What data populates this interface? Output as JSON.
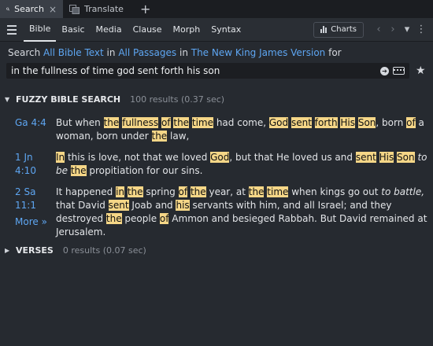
{
  "tabs": [
    {
      "label": "Search",
      "icon": "search-icon",
      "active": true,
      "close": "×"
    },
    {
      "label": "Translate",
      "icon": "translate-icon",
      "active": false
    }
  ],
  "tab_add": "+",
  "toolbar": {
    "items": [
      "Bible",
      "Basic",
      "Media",
      "Clause",
      "Morph",
      "Syntax"
    ],
    "active": "Bible",
    "charts_label": "Charts"
  },
  "scope": {
    "w1": "Search ",
    "link1": "All Bible Text",
    "w2": " in ",
    "link2": "All Passages",
    "w3": " in ",
    "link3": "The New King James Version",
    "w4": " for"
  },
  "search": {
    "value": "in the fullness of time god sent forth his son"
  },
  "fuzzy": {
    "title": "FUZZY BIBLE SEARCH",
    "count": "100 results (0.37 sec)"
  },
  "results": [
    {
      "ref": "Ga 4:4",
      "segments": [
        {
          "t": "But when "
        },
        {
          "t": "the",
          "h": true
        },
        {
          "t": " "
        },
        {
          "t": "fullness",
          "h": true
        },
        {
          "t": " "
        },
        {
          "t": "of",
          "h": true
        },
        {
          "t": " "
        },
        {
          "t": "the",
          "h": true
        },
        {
          "t": " "
        },
        {
          "t": "time",
          "h": true
        },
        {
          "t": " had come, "
        },
        {
          "t": "God",
          "h": true
        },
        {
          "t": " "
        },
        {
          "t": "sent",
          "h": true
        },
        {
          "t": " "
        },
        {
          "t": "forth",
          "h": true
        },
        {
          "t": " "
        },
        {
          "t": "His",
          "h": true
        },
        {
          "t": " "
        },
        {
          "t": "Son",
          "h": true
        },
        {
          "t": ", born "
        },
        {
          "t": "of",
          "h": true
        },
        {
          "t": " a woman, born under "
        },
        {
          "t": "the",
          "h": true
        },
        {
          "t": " law,"
        }
      ]
    },
    {
      "ref": "1 Jn 4:10",
      "segments": [
        {
          "t": "In",
          "h": true
        },
        {
          "t": " this is love, not that we loved "
        },
        {
          "t": "God",
          "h": true
        },
        {
          "t": ", but that He loved us and "
        },
        {
          "t": "sent",
          "h": true
        },
        {
          "t": " "
        },
        {
          "t": "His",
          "h": true
        },
        {
          "t": " "
        },
        {
          "t": "Son",
          "h": true
        },
        {
          "t": " "
        },
        {
          "t": "to be",
          "i": true
        },
        {
          "t": " "
        },
        {
          "t": "the",
          "h": true
        },
        {
          "t": " propitiation for our sins."
        }
      ]
    },
    {
      "ref": "2 Sa 11:1",
      "segments": [
        {
          "t": "It happened "
        },
        {
          "t": "in",
          "h": true
        },
        {
          "t": " "
        },
        {
          "t": "the",
          "h": true
        },
        {
          "t": " spring "
        },
        {
          "t": "of",
          "h": true
        },
        {
          "t": " "
        },
        {
          "t": "the",
          "h": true
        },
        {
          "t": " year, at "
        },
        {
          "t": "the",
          "h": true
        },
        {
          "t": " "
        },
        {
          "t": "time",
          "h": true
        },
        {
          "t": " when kings go out "
        },
        {
          "t": "to battle,",
          "i": true
        },
        {
          "t": " that David "
        },
        {
          "t": "sent",
          "h": true
        },
        {
          "t": " Joab and "
        },
        {
          "t": "his",
          "h": true
        },
        {
          "t": " servants with him, and all Israel; and they destroyed "
        },
        {
          "t": "the",
          "h": true
        },
        {
          "t": " people "
        },
        {
          "t": "of",
          "h": true
        },
        {
          "t": " Ammon and besieged Rabbah. But David remained at Jerusalem."
        }
      ]
    }
  ],
  "more_label": "More »",
  "verses": {
    "title": "VERSES",
    "count": "0 results (0.07 sec)"
  },
  "colors": {
    "highlight": "#f5d687",
    "link": "#5ea6f2",
    "background": "#262a30"
  }
}
